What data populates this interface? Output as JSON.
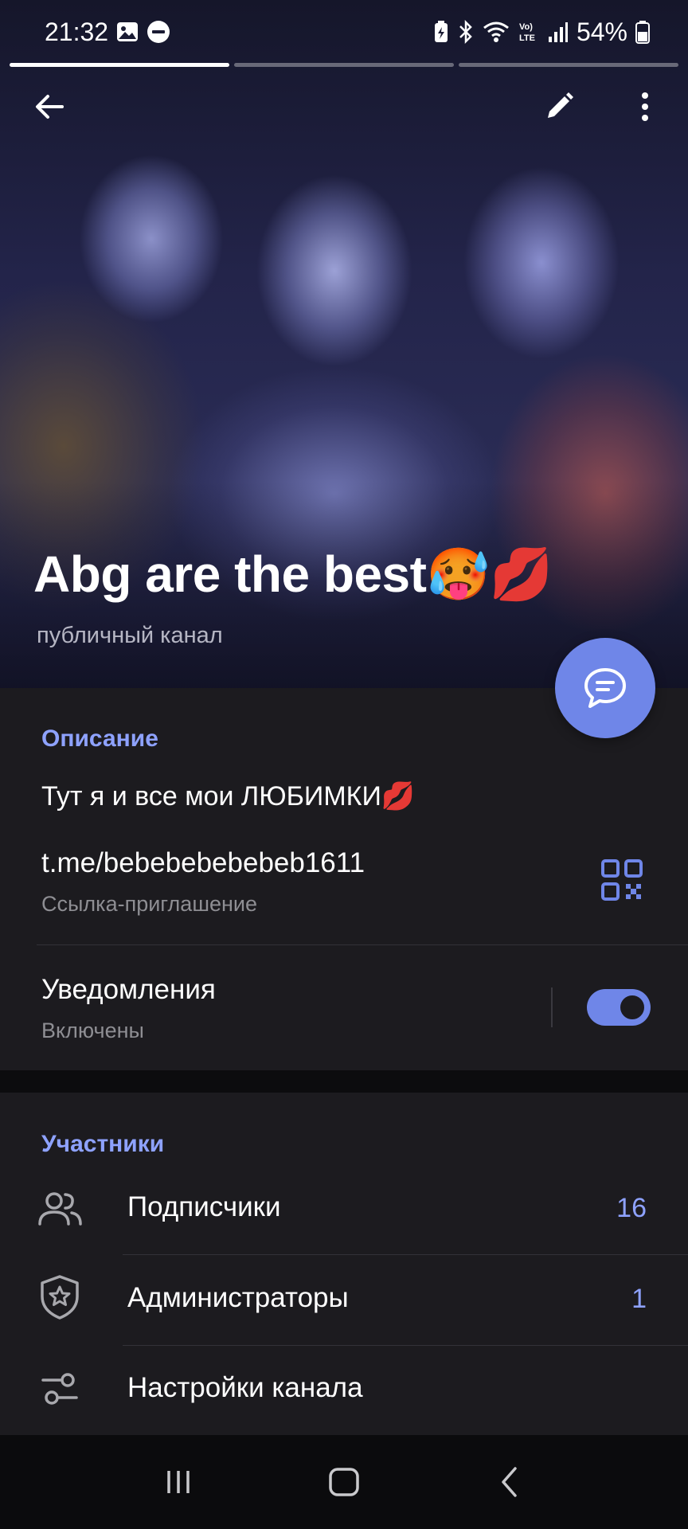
{
  "status_bar": {
    "time": "21:32",
    "battery_percent": "54%",
    "icons_left": [
      "gallery-icon",
      "do-not-disturb-icon"
    ],
    "icons_right": [
      "battery-saver-icon",
      "bluetooth-icon",
      "wifi-icon",
      "volte-icon",
      "signal-icon",
      "battery-icon"
    ]
  },
  "story_progress": {
    "segments": 3,
    "active_index": 0
  },
  "header": {
    "channel_title": "Abg are the best🥵💋",
    "channel_type": "публичный канал",
    "actions": [
      "back-arrow-icon",
      "edit-pencil-icon",
      "more-vert-icon"
    ],
    "fab": "chat-bubble-icon"
  },
  "info": {
    "section_title": "Описание",
    "description": "Тут я и все мои ЛЮБИМКИ💋",
    "link": "t.me/bebebebebebeb1611",
    "link_label": "Ссылка-приглашение",
    "notifications_label": "Уведомления",
    "notifications_state": "Включены",
    "notifications_on": true
  },
  "members": {
    "section_title": "Участники",
    "items": [
      {
        "label": "Подписчики",
        "count": "16",
        "icon": "people-icon"
      },
      {
        "label": "Администраторы",
        "count": "1",
        "icon": "shield-star-icon"
      },
      {
        "label": "Настройки канала",
        "count": "",
        "icon": "sliders-icon"
      }
    ]
  },
  "nav": [
    "recents-icon",
    "home-icon",
    "back-icon"
  ],
  "colors": {
    "accent": "#6f86e8",
    "section_title": "#8ea2ff",
    "background": "#1c1b1f",
    "secondary_text": "#8e8e93"
  }
}
